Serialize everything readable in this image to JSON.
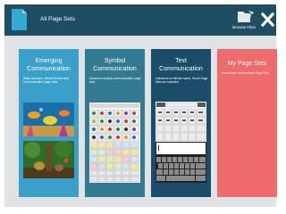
{
  "header": {
    "title": "All Page Sets",
    "browse_label": "Browse Files"
  },
  "cards": [
    {
      "title_line1": "Emerging",
      "title_line2": "Communication",
      "description": "Basic activities, Visual Scenes and Communication page sets."
    },
    {
      "title_line1": "Symbol",
      "title_line2": "Communication",
      "description": "Advanced symbol communication page sets."
    },
    {
      "title_line1": "Text",
      "title_line2": "Communication",
      "description": "Interfaces for literate users. Home Page links are included."
    },
    {
      "title_line1": "My Page Sets",
      "description": "Homemade and modified Page Sets"
    }
  ],
  "colors": {
    "header_bg": "#1f4d63",
    "emerging": "#3aa0c9",
    "symbol": "#317a92",
    "text": "#1b4d6a",
    "my_sets": "#ee6c6b",
    "panel_bg": "#dfe3e5"
  }
}
